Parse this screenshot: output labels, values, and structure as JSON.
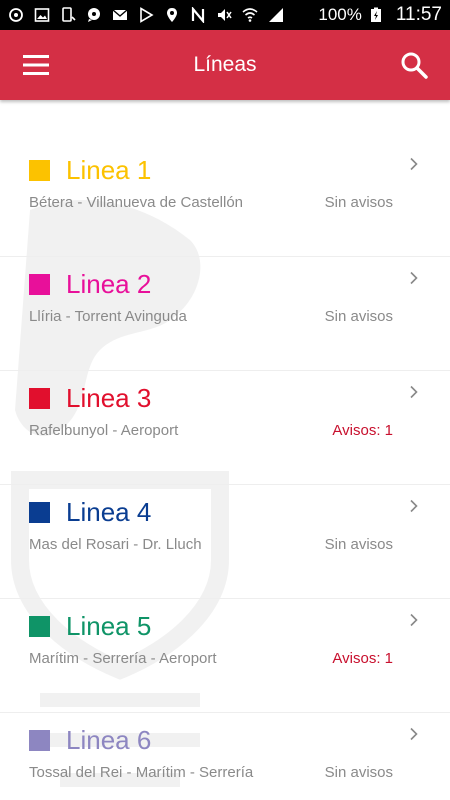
{
  "status_bar": {
    "battery_text": "100%",
    "time": "11:57",
    "left_icons": [
      "sync-icon",
      "image-icon",
      "phone-rotate-icon",
      "chat-icon",
      "mail-icon",
      "play-store-icon",
      "location-icon",
      "nfc-icon",
      "mute-icon",
      "wifi-icon",
      "signal-icon"
    ],
    "right_icons": [
      "battery-charging-icon"
    ]
  },
  "app_bar": {
    "title": "Líneas",
    "accent": "#d42f45"
  },
  "lines": [
    {
      "name": "Linea 1",
      "color": "#fcc200",
      "route": "Bétera - Villanueva de Castellón",
      "status": "Sin avisos",
      "alert": false
    },
    {
      "name": "Linea 2",
      "color": "#e8109a",
      "route": "Llíria - Torrent Avinguda",
      "status": "Sin avisos",
      "alert": false
    },
    {
      "name": "Linea 3",
      "color": "#e10f2d",
      "route": "Rafelbunyol - Aeroport",
      "status": "Avisos: 1",
      "alert": true
    },
    {
      "name": "Linea 4",
      "color": "#0a3d91",
      "route": "Mas del Rosari - Dr. Lluch",
      "status": "Sin avisos",
      "alert": false
    },
    {
      "name": "Linea 5",
      "color": "#0f9467",
      "route": "Marítim - Serrería - Aeroport",
      "status": "Avisos: 1",
      "alert": true
    },
    {
      "name": "Linea 6",
      "color": "#8d86c1",
      "route": "Tossal del Rei - Marítim - Serrería",
      "status": "Sin avisos",
      "alert": false
    }
  ]
}
